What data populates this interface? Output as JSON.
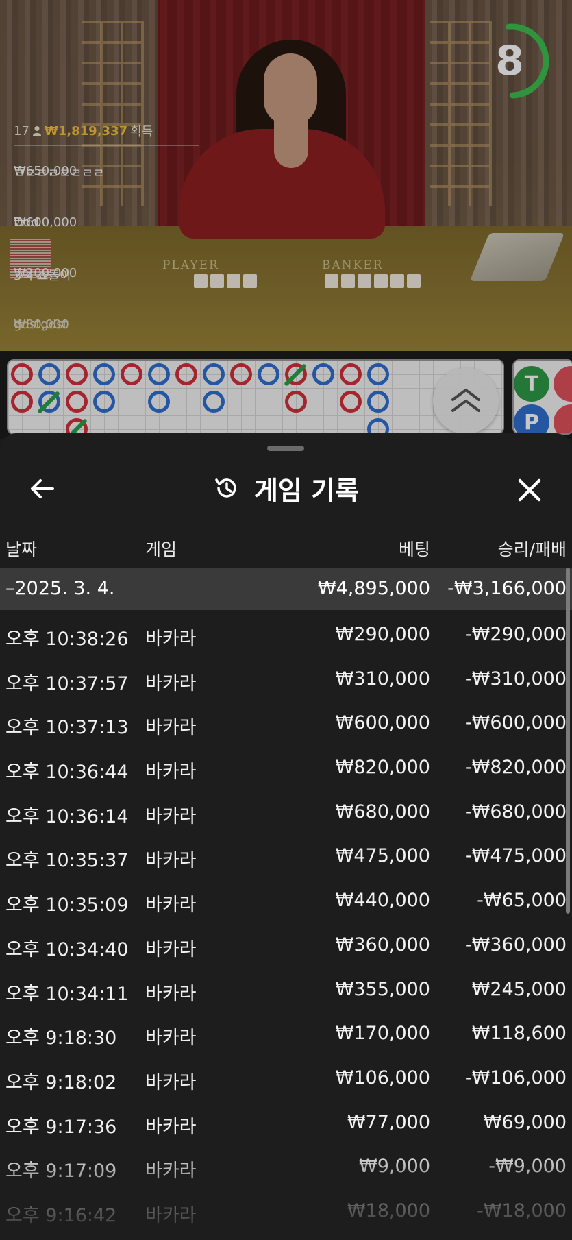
{
  "timer": {
    "value": "8",
    "color": "#3ebd4f"
  },
  "table": {
    "player_label": "PLAYER",
    "banker_label": "BANKER"
  },
  "bets_overlay": {
    "count": "17",
    "total": "₩1,819,337",
    "total_suffix": "획득",
    "rows": [
      {
        "amount": "₩650,000",
        "name": "ㄹㄹㄹㄹㄹㄹㄹㄹ",
        "style": "gold"
      },
      {
        "amount": "₩600,000",
        "name": "Ddd",
        "style": "gold"
      },
      {
        "amount": "₩200,000",
        "name": "3억 쇼돌이",
        "style": "white"
      },
      {
        "amount": "₩80,000",
        "name": "gdstgdst",
        "style": "faded"
      }
    ]
  },
  "side_panel": {
    "tie_label": "T",
    "player_label": "P"
  },
  "history_sheet": {
    "title": "게임 기록",
    "icons": {
      "back": "arrow-left-icon",
      "history": "history-icon",
      "close": "close-icon"
    },
    "columns": {
      "date": "날짜",
      "game": "게임",
      "bet": "베팅",
      "result": "승리/패배"
    },
    "date_group": {
      "label": "–2025. 3. 4.",
      "bet": "₩4,895,000",
      "result": "-₩3,166,000"
    },
    "rows": [
      {
        "time": "오후 10:38:26",
        "game": "바카라",
        "bet": "₩290,000",
        "result": "-₩290,000"
      },
      {
        "time": "오후 10:37:57",
        "game": "바카라",
        "bet": "₩310,000",
        "result": "-₩310,000"
      },
      {
        "time": "오후 10:37:13",
        "game": "바카라",
        "bet": "₩600,000",
        "result": "-₩600,000"
      },
      {
        "time": "오후 10:36:44",
        "game": "바카라",
        "bet": "₩820,000",
        "result": "-₩820,000"
      },
      {
        "time": "오후 10:36:14",
        "game": "바카라",
        "bet": "₩680,000",
        "result": "-₩680,000"
      },
      {
        "time": "오후 10:35:37",
        "game": "바카라",
        "bet": "₩475,000",
        "result": "-₩475,000"
      },
      {
        "time": "오후 10:35:09",
        "game": "바카라",
        "bet": "₩440,000",
        "result": "-₩65,000"
      },
      {
        "time": "오후 10:34:40",
        "game": "바카라",
        "bet": "₩360,000",
        "result": "-₩360,000"
      },
      {
        "time": "오후 10:34:11",
        "game": "바카라",
        "bet": "₩355,000",
        "result": "₩245,000"
      },
      {
        "time": "오후 9:18:30",
        "game": "바카라",
        "bet": "₩170,000",
        "result": "₩118,600"
      },
      {
        "time": "오후 9:18:02",
        "game": "바카라",
        "bet": "₩106,000",
        "result": "-₩106,000"
      },
      {
        "time": "오후 9:17:36",
        "game": "바카라",
        "bet": "₩77,000",
        "result": "₩69,000"
      },
      {
        "time": "오후 9:17:09",
        "game": "바카라",
        "bet": "₩9,000",
        "result": "-₩9,000"
      },
      {
        "time": "오후 9:16:42",
        "game": "바카라",
        "bet": "₩18,000",
        "result": "-₩18,000"
      }
    ]
  }
}
